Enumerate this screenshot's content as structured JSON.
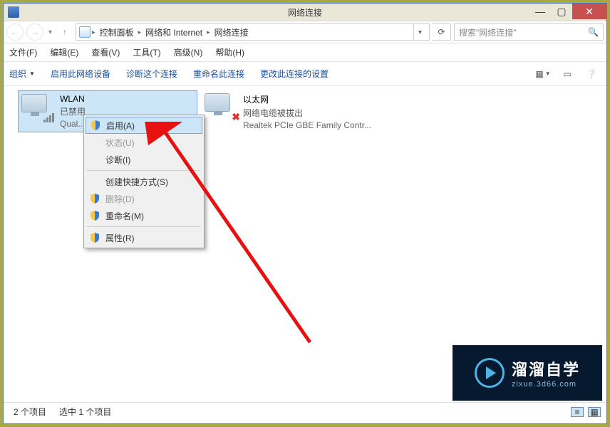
{
  "window": {
    "title": "网络连接"
  },
  "winControls": {
    "min": "—",
    "max": "▢",
    "close": "✕"
  },
  "breadcrumb": {
    "seg1": "控制面板",
    "seg2": "网络和 Internet",
    "seg3": "网络连接"
  },
  "search": {
    "placeholder": "搜索\"网络连接\""
  },
  "menubar": {
    "file": "文件(F)",
    "edit": "编辑(E)",
    "view": "查看(V)",
    "tools": "工具(T)",
    "advanced": "高级(N)",
    "help": "帮助(H)"
  },
  "toolbar": {
    "organize": "组织",
    "enableDevice": "启用此网络设备",
    "diagnose": "诊断这个连接",
    "rename": "重命名此连接",
    "changeSettings": "更改此连接的设置"
  },
  "items": {
    "wlan": {
      "title": "WLAN",
      "status": "已禁用",
      "device": "Qual..."
    },
    "eth": {
      "title": "以太网",
      "status": "网络电缆被拔出",
      "device": "Realtek PCIe GBE Family Contr..."
    }
  },
  "contextMenu": {
    "enable": "启用(A)",
    "status": "状态(U)",
    "diagnose": "诊断(I)",
    "shortcut": "创建快捷方式(S)",
    "delete": "删除(D)",
    "rename": "重命名(M)",
    "properties": "属性(R)"
  },
  "statusbar": {
    "count": "2 个项目",
    "selected": "选中 1 个项目"
  },
  "watermark": {
    "title": "溜溜自学",
    "url": "zixue.3d66.com"
  }
}
